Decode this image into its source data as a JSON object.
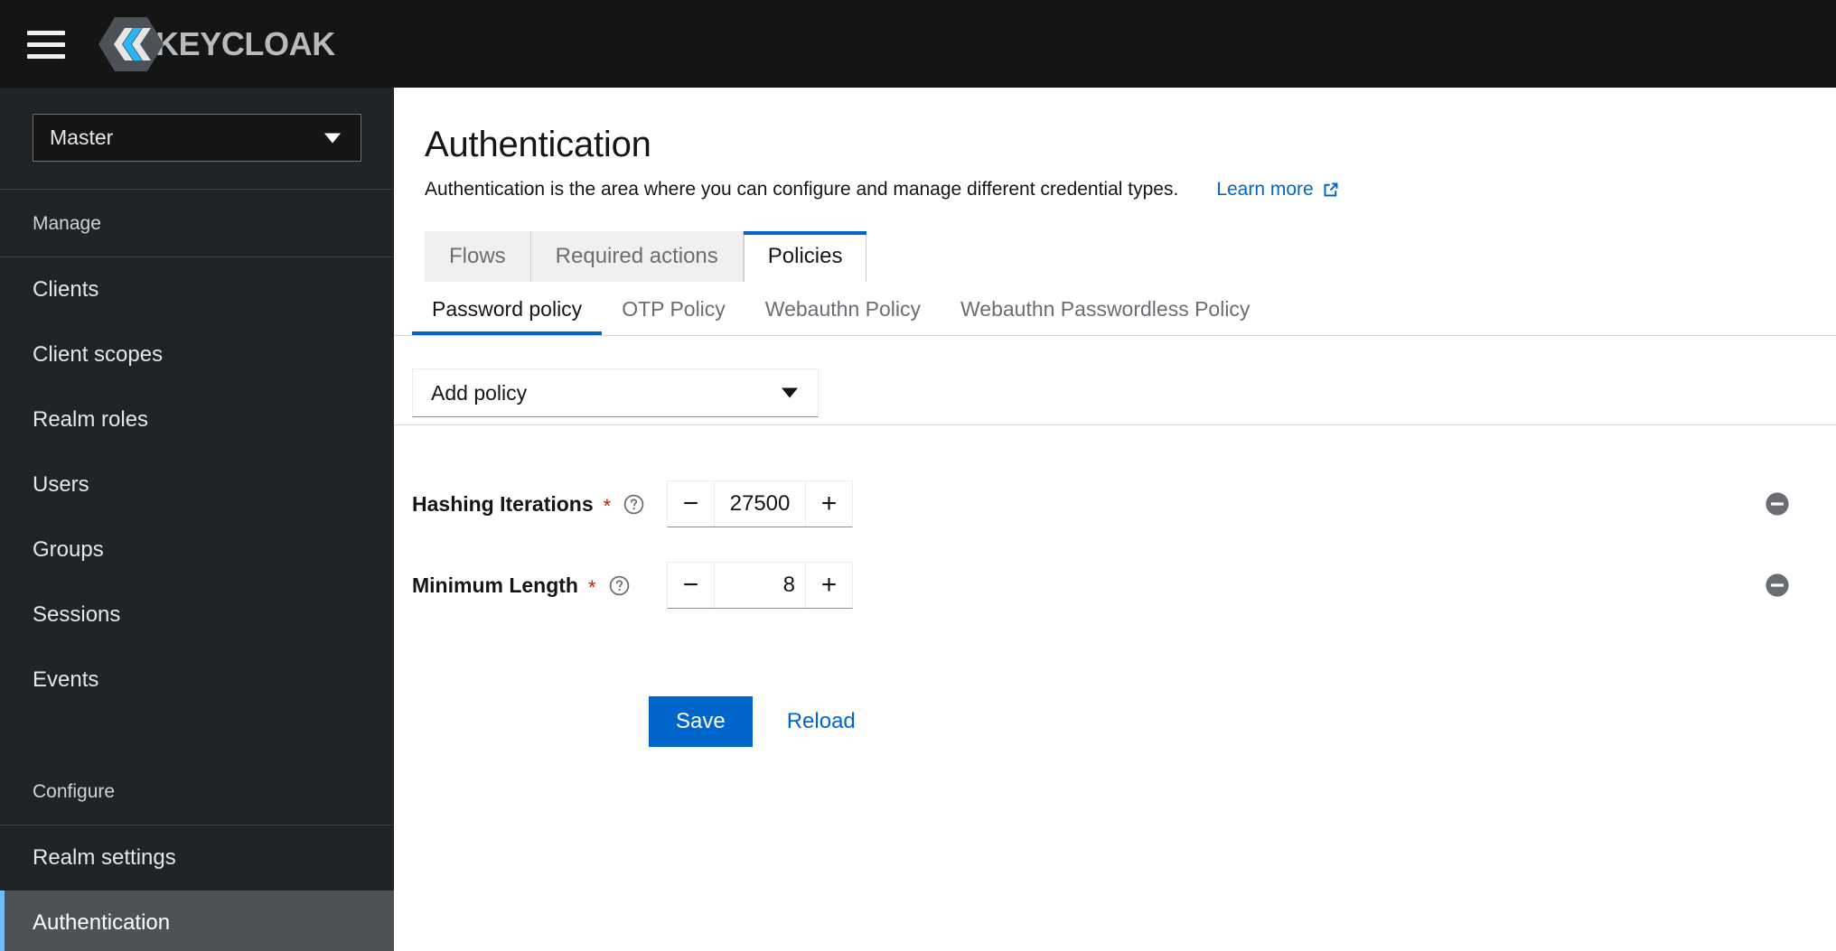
{
  "masthead": {
    "menu_icon": "hamburger-icon",
    "brand_text": "KEYCLOAK",
    "brand_logo_icon": "keycloak-logo-icon"
  },
  "sidebar": {
    "realm_selector": {
      "value": "Master",
      "caret_icon": "caret-down-icon"
    },
    "groups": [
      {
        "title": "Manage",
        "items": [
          {
            "label": "Clients",
            "active": false
          },
          {
            "label": "Client scopes",
            "active": false
          },
          {
            "label": "Realm roles",
            "active": false
          },
          {
            "label": "Users",
            "active": false
          },
          {
            "label": "Groups",
            "active": false
          },
          {
            "label": "Sessions",
            "active": false
          },
          {
            "label": "Events",
            "active": false
          }
        ]
      },
      {
        "title": "Configure",
        "items": [
          {
            "label": "Realm settings",
            "active": false
          },
          {
            "label": "Authentication",
            "active": true
          }
        ]
      }
    ]
  },
  "page": {
    "title": "Authentication",
    "subtitle": "Authentication is the area where you can configure and manage different credential types.",
    "learn_more_label": "Learn more",
    "learn_more_icon": "external-link-icon"
  },
  "tabs": [
    {
      "label": "Flows",
      "active": false
    },
    {
      "label": "Required actions",
      "active": false
    },
    {
      "label": "Policies",
      "active": true
    }
  ],
  "subtabs": [
    {
      "label": "Password policy",
      "active": true
    },
    {
      "label": "OTP Policy",
      "active": false
    },
    {
      "label": "Webauthn Policy",
      "active": false
    },
    {
      "label": "Webauthn Passwordless Policy",
      "active": false
    }
  ],
  "add_policy": {
    "label": "Add policy",
    "caret_icon": "caret-down-icon"
  },
  "policies": [
    {
      "label": "Hashing Iterations",
      "required": "*",
      "help_icon": "help-circle-icon",
      "value": "27500",
      "minus_label": "−",
      "plus_label": "+",
      "align": "center",
      "remove_icon": "minus-circle-icon"
    },
    {
      "label": "Minimum Length",
      "required": "*",
      "help_icon": "help-circle-icon",
      "value": "8",
      "minus_label": "−",
      "plus_label": "+",
      "align": "right",
      "remove_icon": "minus-circle-icon"
    }
  ],
  "actions": {
    "save_label": "Save",
    "reload_label": "Reload"
  },
  "colors": {
    "accent_blue": "#0066cc",
    "link_blue": "#0066cc",
    "active_nav_bar": "#73bcf7",
    "required_red": "#c9190b",
    "sidebar_bg": "#212427",
    "masthead_bg": "#151515",
    "remove_icon_gray": "#6a6e73"
  }
}
